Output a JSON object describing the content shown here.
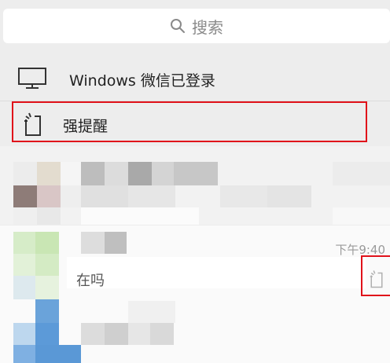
{
  "search": {
    "placeholder": "搜索",
    "icon": "search-icon"
  },
  "session_rows": [
    {
      "label": "Windows 微信已登录",
      "icon": "desktop-monitor-icon"
    },
    {
      "label": "强提醒",
      "icon": "strong-reminder-icon"
    }
  ],
  "chat": {
    "time": "下午9:40",
    "preview": "在吗",
    "status_icon": "strong-reminder-icon"
  },
  "colors": {
    "highlight": "#e0111a",
    "background": "#ededed",
    "row": "#ffffff"
  }
}
